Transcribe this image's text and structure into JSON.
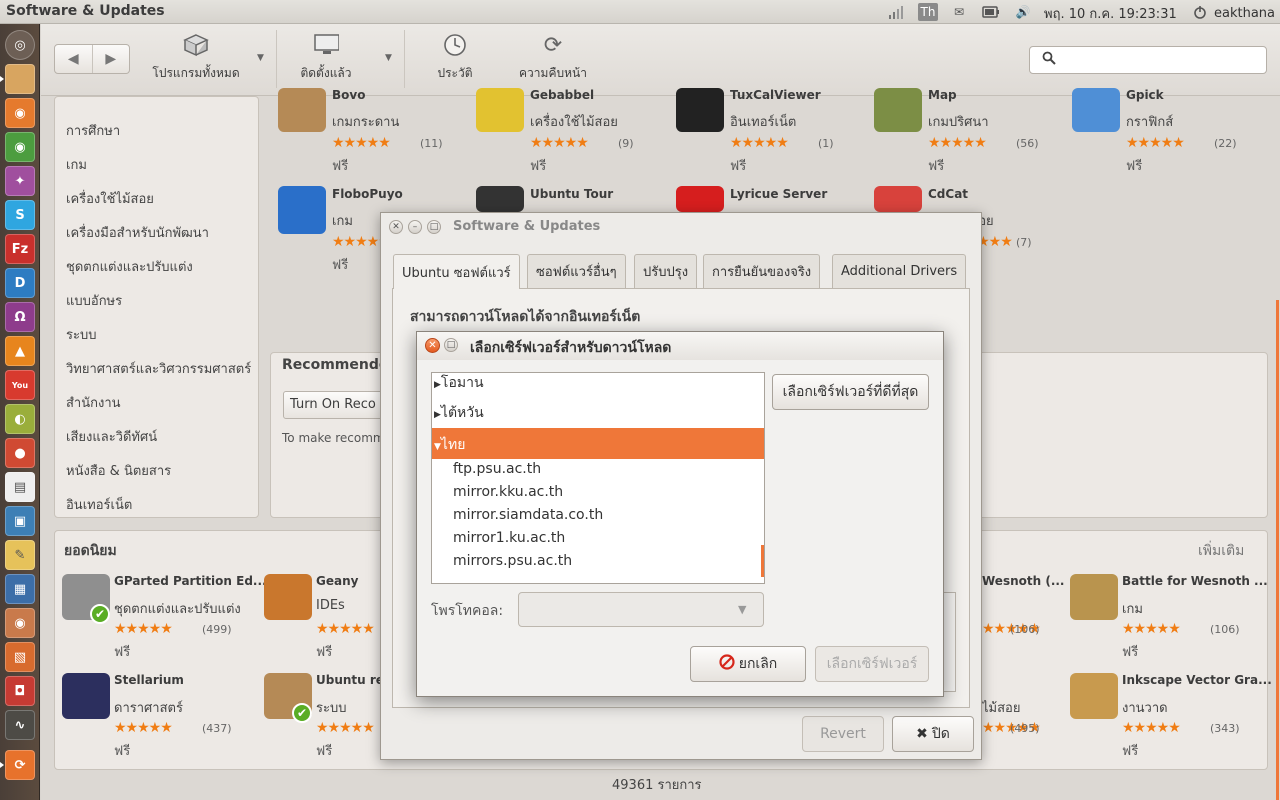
{
  "panel": {
    "app_title": "Software & Updates",
    "keyboard_indicator": "Th",
    "clock": "พฤ. 10 ก.ค. 19:23:31",
    "username": "eakthana"
  },
  "launcher": {
    "icons": [
      "ubuntu-icon",
      "files-icon",
      "firefox-icon",
      "chrome-icon",
      "app-icon",
      "skype-icon",
      "filezilla-icon",
      "app-d-icon",
      "headphones-icon",
      "vlc-icon",
      "youtube-icon",
      "app-icon",
      "app-icon",
      "text-editor-icon",
      "app-icon",
      "notes-icon",
      "app-icon",
      "eye-icon",
      "app-icon",
      "app-icon",
      "monitor-icon",
      "software-updates-icon"
    ]
  },
  "toolbar": {
    "all_software": "โปรแกรมทั้งหมด",
    "installed": "ติดตั้งแล้ว",
    "history": "ประวัติ",
    "progress": "ความคืบหน้า"
  },
  "categories": [
    "การศึกษา",
    "เกม",
    "เครื่องใช้ไม้สอย",
    "เครื่องมือสำหรับนักพัฒนา",
    "ชุดตกแต่งและปรับแต่ง",
    "แบบอักษร",
    "ระบบ",
    "วิทยาศาสตร์และวิศวกรรมศาสตร์",
    "สำนักงาน",
    "เสียงและวิดีทัศน์",
    "หนังสือ & นิตยสาร",
    "อินเทอร์เน็ต"
  ],
  "apps_row1": [
    {
      "name": "Bovo",
      "category": "เกมกระดาน",
      "rating": "(11)",
      "price": "ฟรี"
    },
    {
      "name": "Gebabbel",
      "category": "เครื่องใช้ไม้สอย",
      "rating": "(9)",
      "price": "ฟรี"
    },
    {
      "name": "TuxCalViewer",
      "category": "อินเทอร์เน็ต",
      "rating": "(1)",
      "price": "ฟรี"
    },
    {
      "name": "Map",
      "category": "เกมปริศนา",
      "rating": "(56)",
      "price": "ฟรี"
    },
    {
      "name": "Gpick",
      "category": "กราฟิกส์",
      "rating": "(22)",
      "price": "ฟรี"
    }
  ],
  "apps_row2": [
    {
      "name": "FloboPuyo",
      "category": "เกม",
      "price": "ฟรี"
    },
    {
      "name": "Ubuntu Tour"
    },
    {
      "name": "Lyricue Server"
    },
    {
      "name": "CdCat",
      "category": "ใช้ไม้สอย",
      "rating": "(7)"
    }
  ],
  "recommended": {
    "title": "Recommende",
    "turn_on": "Turn On Reco",
    "text": "To make recomme"
  },
  "top_rated": {
    "title": "ยอดนิยม",
    "more": "เพิ่มเติม",
    "apps": [
      {
        "name": "GParted Partition Ed...",
        "category": "ชุดตกแต่งและปรับแต่ง",
        "rating": "(499)",
        "price": "ฟรี"
      },
      {
        "name": "Geany",
        "category": "IDEs",
        "price": "ฟรี"
      },
      {
        "name": "Wesnoth (...",
        "rating": "(106)"
      },
      {
        "name": "Battle for Wesnoth ...",
        "category": "เกม",
        "rating": "(106)",
        "price": "ฟรี"
      },
      {
        "name": "Stellarium",
        "category": "ดาราศาสตร์",
        "rating": "(437)",
        "price": "ฟรี"
      },
      {
        "name": "Ubuntu rest",
        "category": "ระบบ",
        "price": "ฟรี"
      },
      {
        "name": "",
        "category": "ไม้สอย",
        "rating": "(495)"
      },
      {
        "name": "Inkscape Vector Gra...",
        "category": "งานวาด",
        "rating": "(343)",
        "price": "ฟรี"
      }
    ]
  },
  "status": "49361 รายการ",
  "su_dialog": {
    "title": "Software & Updates",
    "tabs": [
      "Ubuntu ซอฟต์แวร์",
      "ซอฟต์แวร์อื่นๆ",
      "ปรับปรุง",
      "การยืนยันของจริง",
      "Additional Drivers"
    ],
    "heading": "สามารถดาวน์โหลดได้จากอินเทอร์เน็ต",
    "revert": "Revert",
    "close": "ปิด"
  },
  "server_dialog": {
    "title": "เลือกเซิร์ฟเวอร์สำหรับดาวน์โหลด",
    "countries": [
      "โอมาน",
      "ไต้หวัน",
      "ไทย"
    ],
    "servers": [
      "ftp.psu.ac.th",
      "mirror.kku.ac.th",
      "mirror.siamdata.co.th",
      "mirror1.ku.ac.th",
      "mirrors.psu.ac.th"
    ],
    "best_server": "เลือกเซิร์ฟเวอร์ที่ดีที่สุด",
    "protocol_label": "โพรโทคอล:",
    "cancel": "ยกเลิก",
    "choose": "เลือกเซิร์ฟเวอร์"
  },
  "colors": {
    "accent": "#ef7739",
    "star": "#f07d14"
  }
}
